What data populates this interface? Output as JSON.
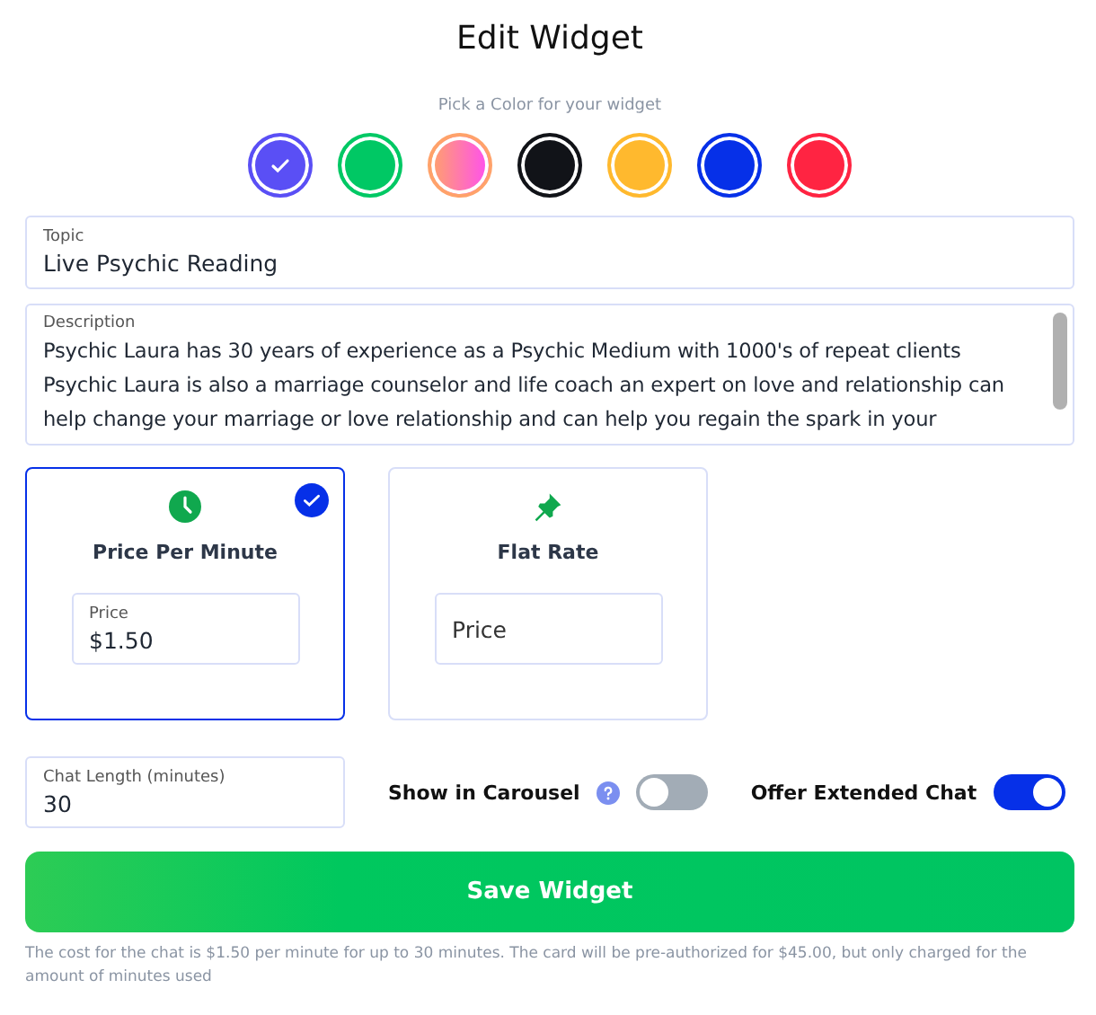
{
  "title": "Edit Widget",
  "color_prompt": "Pick a Color for your widget",
  "colors": [
    {
      "kind": "solid",
      "color": "#5a4ff5",
      "selected": true
    },
    {
      "kind": "solid",
      "color": "#00c864",
      "selected": false
    },
    {
      "kind": "gradient",
      "color": "#ffa26a",
      "selected": false
    },
    {
      "kind": "solid",
      "color": "#111318",
      "selected": false
    },
    {
      "kind": "solid",
      "color": "#ffb92e",
      "selected": false
    },
    {
      "kind": "solid",
      "color": "#0630e8",
      "selected": false
    },
    {
      "kind": "solid",
      "color": "#ff2442",
      "selected": false
    }
  ],
  "topic": {
    "label": "Topic",
    "value": "Live Psychic Reading"
  },
  "description": {
    "label": "Description",
    "value": "Psychic Laura has 30 years of experience as a Psychic Medium with 1000's of repeat clients\nPsychic Laura is also a marriage counselor and life coach an expert on love and relationship can help change your marriage or love relationship and can help you regain the spark in your"
  },
  "pricing": [
    {
      "kind": "clock",
      "title": "Price Per Minute",
      "selected": true,
      "field": {
        "label": "Price",
        "value": "$1.50"
      }
    },
    {
      "kind": "pin",
      "title": "Flat Rate",
      "selected": false,
      "field": {
        "placeholder": "Price"
      }
    }
  ],
  "chat_length": {
    "label": "Chat Length (minutes)",
    "value": "30"
  },
  "toggles": [
    {
      "label": "Show in Carousel",
      "help": true,
      "on": false
    },
    {
      "label": "Offer Extended Chat",
      "help": false,
      "on": true
    }
  ],
  "save_button": "Save Widget",
  "note": "The cost for the chat is $1.50 per minute for up to 30 minutes. The card will be pre-authorized for $45.00, but only charged for the amount of minutes used"
}
